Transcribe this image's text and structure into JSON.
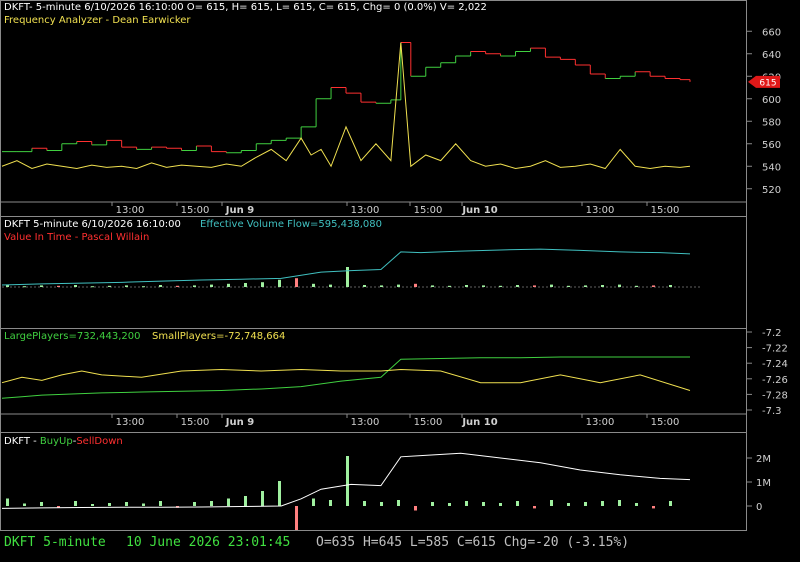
{
  "colors": {
    "background": "#000000",
    "border": "#8a8a8a",
    "axis_text": "#d0d0d0",
    "title_white": "#ffffff",
    "yellow": "#f0e050",
    "red": "#ff3030",
    "green": "#40d040",
    "cyan": "#40c0c0",
    "pink": "#ff8080",
    "light_green": "#a0f0a0",
    "status_green": "#40e040",
    "status_gray": "#c0c0c0",
    "price_tag": "#e01818"
  },
  "panel1": {
    "title": "DKFT- 5-minute 6/10/2026 16:10:00 O= 615, H= 615, L= 615, C= 615, Chg= 0 (0.0%) V= 2,022",
    "indicator": "Frequency Analyzer - Dean Earwicker",
    "price_tag": "615",
    "yticks": [
      "660",
      "640",
      "620",
      "600",
      "580",
      "560",
      "540",
      "520"
    ]
  },
  "time_axis": {
    "labels": [
      "13:00",
      "15:00",
      "Jun 9",
      "13:00",
      "15:00",
      "Jun 10",
      "13:00",
      "15:00"
    ]
  },
  "panel2": {
    "title_prefix": "DKFT 5-minute  6/10/2026 16:10:00",
    "title_value": "Effective Volume Flow=595,438,080",
    "indicator": "Value In Time - Pascal Willain"
  },
  "panel3": {
    "large_label": "LargePlayers=732,443,200",
    "small_label": "SmallPlayers=-72,748,664",
    "yticks": [
      "-7.2",
      "-7.22",
      "-7.24",
      "-7.26",
      "-7.28",
      "-7.3"
    ]
  },
  "panel4": {
    "title_prefix": "DKFT - ",
    "buy_label": "BuyUp",
    "sep": "-",
    "sell_label": "SellDown",
    "yticks": [
      "2M",
      "1M",
      "0"
    ]
  },
  "status": {
    "symbol": "DKFT  5-minute",
    "datetime": "10 June 2026 23:01:45",
    "ohlc": "O=635  H=645  L=585  C=615  Chg=-20 (-3.15%)"
  },
  "chart_data": [
    {
      "type": "bar",
      "name_note": "price panel (OHLC step bars colored green up / red down)",
      "x": [
        0,
        15,
        30,
        45,
        60,
        75,
        90,
        105,
        120,
        135,
        150,
        165,
        180,
        195,
        210,
        225,
        240,
        255,
        270,
        285,
        300,
        315,
        330,
        345,
        360,
        375,
        390,
        400,
        410,
        425,
        440,
        455,
        470,
        485,
        500,
        515,
        530,
        545,
        560,
        575,
        590,
        605,
        620,
        635,
        650,
        665,
        680,
        690
      ],
      "close": [
        553,
        553,
        556,
        554,
        560,
        562,
        559,
        563,
        557,
        555,
        557,
        556,
        554,
        558,
        553,
        552,
        554,
        560,
        563,
        565,
        575,
        600,
        610,
        605,
        597,
        596,
        599,
        650,
        620,
        628,
        632,
        638,
        642,
        640,
        638,
        642,
        645,
        637,
        635,
        630,
        622,
        618,
        620,
        624,
        620,
        618,
        617,
        615
      ],
      "ylim": [
        510,
        670
      ],
      "yticks": [
        660,
        640,
        620,
        600,
        580,
        560,
        540,
        520
      ],
      "indicator_line": {
        "name": "Frequency Analyzer - Dean Earwicker",
        "x": [
          0,
          15,
          30,
          45,
          60,
          75,
          90,
          105,
          120,
          135,
          150,
          165,
          180,
          195,
          210,
          225,
          240,
          255,
          270,
          285,
          300,
          310,
          320,
          330,
          345,
          360,
          375,
          390,
          400,
          410,
          425,
          440,
          455,
          470,
          485,
          500,
          515,
          530,
          545,
          560,
          575,
          590,
          605,
          620,
          635,
          650,
          665,
          680,
          690
        ],
        "values": [
          540,
          545,
          538,
          542,
          540,
          538,
          541,
          539,
          540,
          538,
          543,
          539,
          541,
          540,
          539,
          542,
          540,
          548,
          555,
          545,
          565,
          550,
          555,
          540,
          575,
          545,
          560,
          545,
          650,
          540,
          550,
          545,
          560,
          545,
          540,
          542,
          538,
          540,
          545,
          539,
          540,
          542,
          538,
          555,
          540,
          538,
          540,
          539,
          540
        ]
      }
    },
    {
      "type": "line",
      "name_note": "Effective Volume Flow / Value In Time panel",
      "x": [
        0,
        40,
        80,
        120,
        160,
        200,
        240,
        280,
        300,
        320,
        350,
        380,
        400,
        420,
        460,
        500,
        540,
        580,
        620,
        660,
        690
      ],
      "series": [
        {
          "name": "Effective Volume Flow=595,438,080",
          "values": [
            0.05,
            0.08,
            0.1,
            0.12,
            0.15,
            0.18,
            0.2,
            0.22,
            0.3,
            0.38,
            0.42,
            0.45,
            0.9,
            0.88,
            0.92,
            0.95,
            0.97,
            0.94,
            0.9,
            0.88,
            0.85
          ]
        }
      ],
      "volume_bars": [
        0.06,
        0.02,
        0.04,
        0.03,
        0.05,
        0.02,
        0.03,
        0.04,
        0.02,
        0.05,
        0.03,
        0.04,
        0.06,
        0.08,
        0.1,
        0.12,
        0.18,
        0.22,
        0.08,
        0.06,
        0.5,
        0.05,
        0.04,
        0.06,
        0.08,
        0.04,
        0.03,
        0.05,
        0.04,
        0.03,
        0.05,
        0.04,
        0.06,
        0.03,
        0.04,
        0.05,
        0.06,
        0.03,
        0.04,
        0.05
      ]
    },
    {
      "type": "line",
      "name_note": "Large / Small players panel",
      "x": [
        0,
        20,
        40,
        60,
        80,
        100,
        140,
        180,
        220,
        260,
        300,
        340,
        380,
        400,
        440,
        480,
        520,
        560,
        600,
        640,
        690
      ],
      "series": [
        {
          "name": "LargePlayers=732,443,200",
          "values": [
            -7.285,
            -7.283,
            -7.281,
            -7.28,
            -7.279,
            -7.278,
            -7.277,
            -7.276,
            -7.275,
            -7.273,
            -7.27,
            -7.263,
            -7.258,
            -7.235,
            -7.234,
            -7.233,
            -7.233,
            -7.232,
            -7.232,
            -7.232,
            -7.232
          ]
        },
        {
          "name": "SmallPlayers=-72,748,664",
          "values": [
            -7.265,
            -7.258,
            -7.262,
            -7.255,
            -7.25,
            -7.255,
            -7.258,
            -7.25,
            -7.248,
            -7.25,
            -7.248,
            -7.25,
            -7.25,
            -7.248,
            -7.25,
            -7.265,
            -7.265,
            -7.255,
            -7.265,
            -7.255,
            -7.275
          ]
        }
      ],
      "ylim": [
        -7.3,
        -7.2
      ]
    },
    {
      "type": "line",
      "name_note": "BuyUp - SellDown panel",
      "x": [
        0,
        40,
        80,
        120,
        160,
        200,
        240,
        280,
        300,
        320,
        350,
        380,
        400,
        420,
        460,
        500,
        540,
        580,
        620,
        660,
        690
      ],
      "series": [
        {
          "name": "BuyUp-SellDown",
          "values": [
            -0.1,
            -0.08,
            -0.06,
            -0.05,
            -0.05,
            -0.04,
            -0.02,
            0,
            0.3,
            0.7,
            0.9,
            0.85,
            2.05,
            2.1,
            2.2,
            2.0,
            1.8,
            1.5,
            1.3,
            1.15,
            1.1
          ]
        }
      ],
      "volume_bars": [
        0.15,
        0.05,
        0.08,
        0.06,
        0.1,
        0.04,
        0.06,
        0.08,
        0.05,
        0.1,
        0.06,
        0.08,
        0.1,
        0.15,
        0.2,
        0.3,
        0.5,
        0.8,
        0.15,
        0.12,
        1.0,
        0.1,
        0.08,
        0.12,
        0.15,
        0.08,
        0.06,
        0.1,
        0.08,
        0.06,
        0.1,
        0.08,
        0.12,
        0.06,
        0.08,
        0.1,
        0.12,
        0.06,
        0.08,
        0.1
      ],
      "yticks": [
        "2M",
        "1M",
        "0"
      ]
    }
  ]
}
